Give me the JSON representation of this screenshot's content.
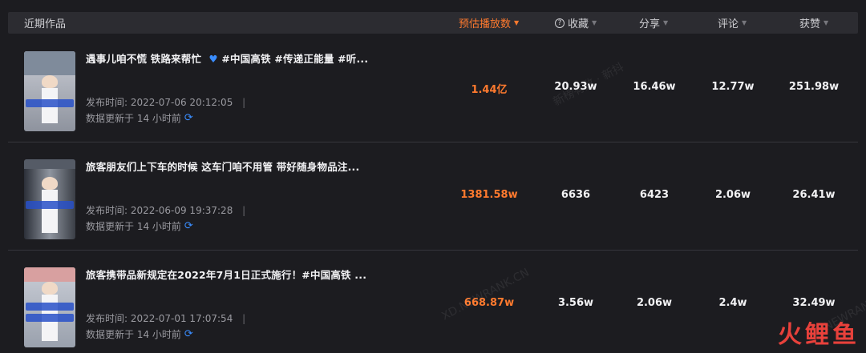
{
  "header": {
    "title": "近期作品",
    "columns": {
      "plays": "预估播放数",
      "favorites": "收藏",
      "shares": "分享",
      "comments": "评论",
      "likes": "获赞"
    },
    "sorted_column": "plays"
  },
  "rows": [
    {
      "title": "遇事儿咱不慌 铁路来帮忙",
      "title_tail": " #中国高铁 #传递正能量 #听...",
      "has_heart": true,
      "publish_label": "发布时间:",
      "publish_time": "2022-07-06 20:12:05",
      "update_text": "数据更新于 14 小时前",
      "plays": "1.44亿",
      "favorites": "20.93w",
      "shares": "16.46w",
      "comments": "12.77w",
      "likes": "251.98w",
      "thumb_icon": "video-thumbnail-icon"
    },
    {
      "title": "旅客朋友们上下车的时候 这车门咱不用管 带好随身物品注...",
      "title_tail": "",
      "has_heart": false,
      "publish_label": "发布时间:",
      "publish_time": "2022-06-09 19:37:28",
      "update_text": "数据更新于 14 小时前",
      "plays": "1381.58w",
      "favorites": "6636",
      "shares": "6423",
      "comments": "2.06w",
      "likes": "26.41w",
      "thumb_icon": "video-thumbnail-icon"
    },
    {
      "title": "旅客携带品新规定在2022年7月1日正式施行！#中国高铁 ...",
      "title_tail": "",
      "has_heart": false,
      "publish_label": "发布时间:",
      "publish_time": "2022-07-01 17:07:54",
      "update_text": "数据更新于 14 小时前",
      "plays": "668.87w",
      "favorites": "3.56w",
      "shares": "2.06w",
      "comments": "2.4w",
      "likes": "32.49w",
      "thumb_icon": "video-thumbnail-icon"
    }
  ],
  "watermarks": [
    "新榜有数 · 新抖",
    "XD.NEWRANK.CN",
    "XD.NEWRANK.CN"
  ],
  "logo": {
    "chars": [
      "火",
      "鲤",
      "鱼"
    ]
  },
  "colors": {
    "accent": "#ff7a2e",
    "refresh": "#3a8dff",
    "logo": "#e8413b"
  }
}
